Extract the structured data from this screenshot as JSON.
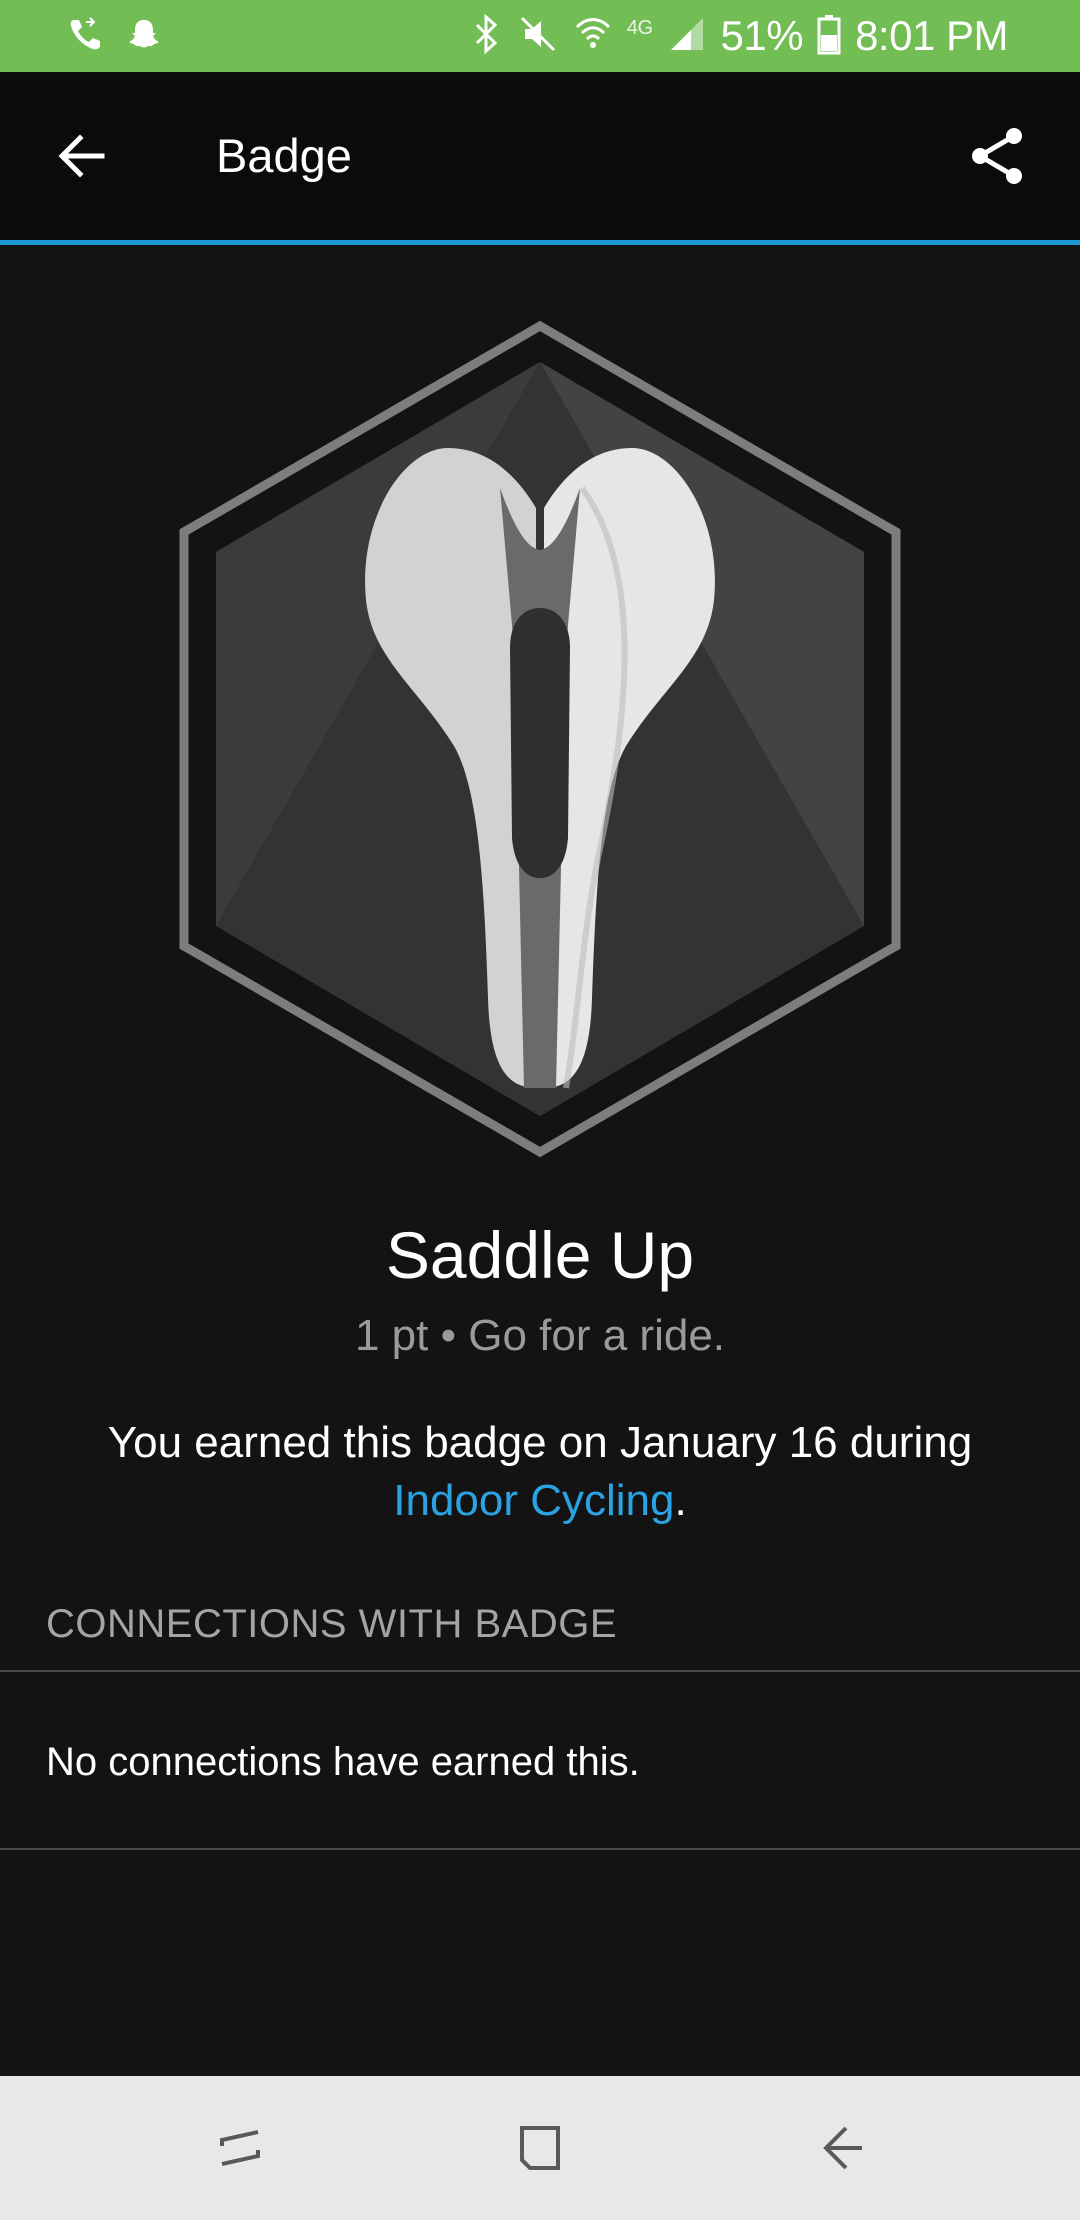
{
  "status_bar": {
    "battery": "51%",
    "time": "8:01 PM",
    "network": "4G",
    "bg_color": "#73bd55",
    "icons": [
      "wifi-call-icon",
      "snapchat-icon",
      "bluetooth-icon",
      "mute-icon",
      "wifi-icon",
      "signal-icon",
      "battery-icon"
    ]
  },
  "app_bar": {
    "title": "Badge",
    "accent_color": "#1f98d8"
  },
  "badge": {
    "name": "Saddle Up",
    "description": "1 pt • Go for a ride.",
    "icon": "bike-saddle-icon",
    "earned_prefix": "You earned this badge on January 16 during",
    "activity_link": "Indoor Cycling",
    "earned_suffix": "."
  },
  "connections": {
    "header": "CONNECTIONS WITH BADGE",
    "empty_text": "No connections have earned this."
  },
  "nav_bar": {
    "buttons": [
      "recent-apps-icon",
      "home-icon",
      "back-icon"
    ]
  }
}
